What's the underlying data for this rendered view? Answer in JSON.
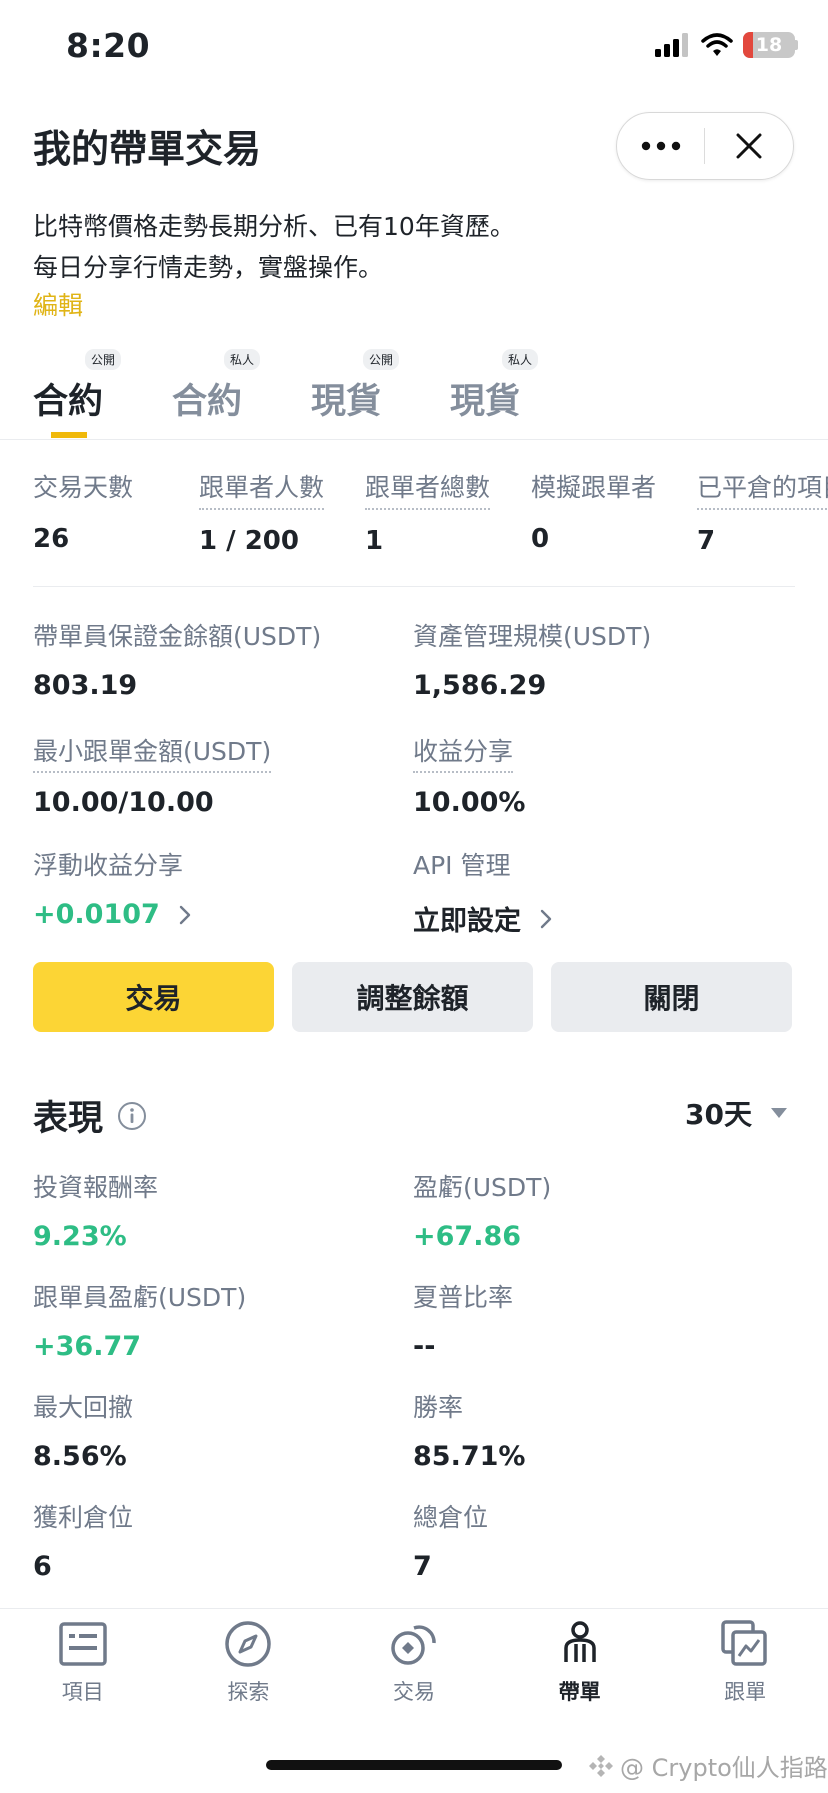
{
  "status": {
    "time": "8:20",
    "battery": "18"
  },
  "header": {
    "title": "我的帶單交易"
  },
  "description": {
    "line1": "比特幣價格走勢長期分析、已有10年資歷。",
    "line2": "每日分享行情走勢，實盤操作。",
    "edit_label": "編輯"
  },
  "tabs": [
    {
      "label": "合約",
      "badge": "公開"
    },
    {
      "label": "合約",
      "badge": "私人"
    },
    {
      "label": "現貨",
      "badge": "公開"
    },
    {
      "label": "現貨",
      "badge": "私人"
    }
  ],
  "stats": [
    {
      "label": "交易天數",
      "value": "26"
    },
    {
      "label": "跟單者人數",
      "value": "1 / 200"
    },
    {
      "label": "跟單者總數",
      "value": "1"
    },
    {
      "label": "模擬跟單者",
      "value": "0"
    },
    {
      "label": "已平倉的項目",
      "value": "7"
    }
  ],
  "details": {
    "margin_balance": {
      "label": "帶單員保證金餘額(USDT)",
      "value": "803.19"
    },
    "aum": {
      "label": "資產管理規模(USDT)",
      "value": "1,586.29"
    },
    "min_copy": {
      "label": "最小跟單金額(USDT)",
      "value": "10.00/10.00"
    },
    "profit_share": {
      "label": "收益分享",
      "value": "10.00%"
    },
    "floating_share": {
      "label": "浮動收益分享",
      "value": "+0.0107"
    },
    "api": {
      "label": "API 管理",
      "value": "立即設定"
    }
  },
  "buttons": {
    "trade": "交易",
    "adjust": "調整餘額",
    "close": "關閉"
  },
  "performance": {
    "title": "表現",
    "period": "30天",
    "items": [
      {
        "label": "投資報酬率",
        "value": "9.23%"
      },
      {
        "label": "盈虧(USDT)",
        "value": "+67.86"
      },
      {
        "label": "跟單員盈虧(USDT)",
        "value": "+36.77"
      },
      {
        "label": "夏普比率",
        "value": "--"
      },
      {
        "label": "最大回撤",
        "value": "8.56%"
      },
      {
        "label": "勝率",
        "value": "85.71%"
      },
      {
        "label": "獲利倉位",
        "value": "6"
      },
      {
        "label": "總倉位",
        "value": "7"
      }
    ]
  },
  "nav": [
    {
      "label": "項目",
      "icon": "list-icon"
    },
    {
      "label": "探索",
      "icon": "compass-icon"
    },
    {
      "label": "交易",
      "icon": "trade-icon"
    },
    {
      "label": "帶單",
      "icon": "lead-trader-icon"
    },
    {
      "label": "跟單",
      "icon": "copy-chart-icon"
    }
  ],
  "watermark": "@ Crypto仙人指路",
  "colors": {
    "accent": "#FCD535",
    "positive": "#2EBD85",
    "link": "#E0B416"
  }
}
